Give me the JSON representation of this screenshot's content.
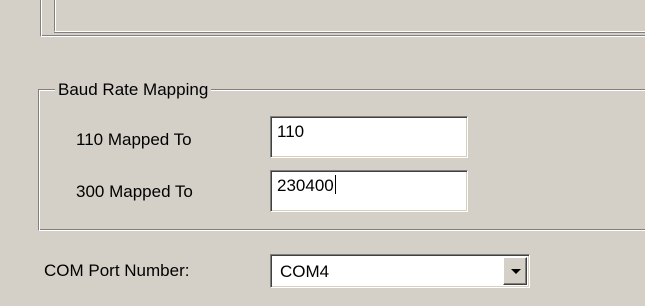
{
  "baud_rate_mapping": {
    "group_title": "Baud Rate Mapping",
    "rows": [
      {
        "label": "110 Mapped To",
        "value": "110"
      },
      {
        "label": "300 Mapped To",
        "value": "230400"
      }
    ]
  },
  "com_port": {
    "label": "COM Port Number:",
    "selected": "COM4",
    "dropdown_icon": "chevron-down-icon"
  },
  "colors": {
    "dialog_background": "#d4d0c8",
    "field_background": "#ffffff",
    "shadow": "#808080",
    "highlight": "#ffffff"
  }
}
